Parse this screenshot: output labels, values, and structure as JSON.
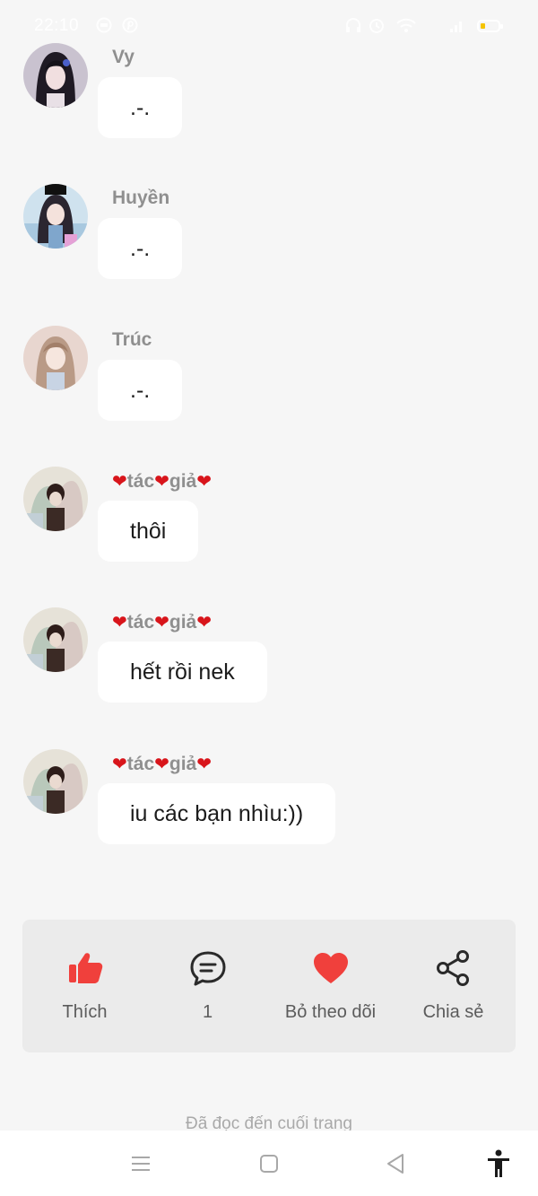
{
  "status_bar": {
    "time": "22:10",
    "battery_level": 0.2,
    "battery_color": "#f5c400"
  },
  "comments": [
    {
      "author": "Vy",
      "text": ".-.",
      "avatar_icon": "anime-girl-avatar"
    },
    {
      "author": "Huyền",
      "text": ".-.",
      "avatar_icon": "anime-girl-avatar"
    },
    {
      "author": "Trúc",
      "text": ".-.",
      "avatar_icon": "anime-girl-avatar"
    },
    {
      "author_parts": [
        "tác",
        "giả"
      ],
      "text": "thôi",
      "avatar_icon": "couple-avatar"
    },
    {
      "author_parts": [
        "tác",
        "giả"
      ],
      "text": "hết rồi nek",
      "avatar_icon": "couple-avatar"
    },
    {
      "author_parts": [
        "tác",
        "giả"
      ],
      "text": "iu các bạn nhìu:))",
      "avatar_icon": "couple-avatar"
    }
  ],
  "actions": {
    "like": {
      "label": "Thích",
      "icon": "thumbs-up-icon"
    },
    "comments": {
      "label": "1",
      "icon": "comment-icon"
    },
    "follow": {
      "label": "Bỏ theo dõi",
      "icon": "heart-icon"
    },
    "share": {
      "label": "Chia sẻ",
      "icon": "share-icon"
    }
  },
  "end_text": "Đã đọc đến cuối trang",
  "colors": {
    "accent_red": "#f0403c",
    "heart_emoji": "#d8151b",
    "background": "#f6f6f6"
  }
}
